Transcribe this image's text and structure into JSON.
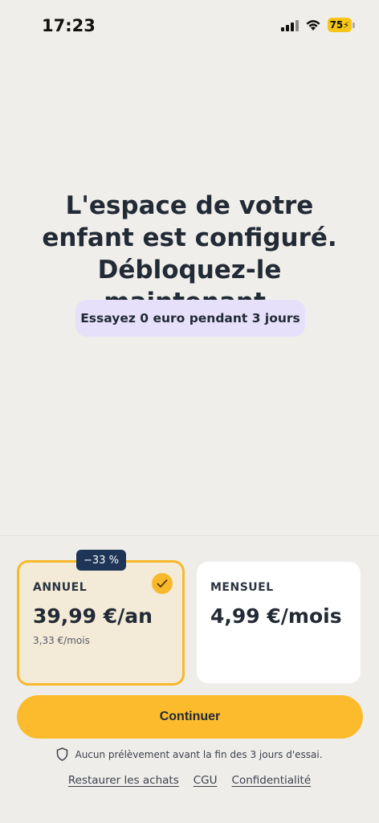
{
  "status_bar": {
    "time": "17:23",
    "battery": "75"
  },
  "main": {
    "headline": "L'espace de votre enfant est configuré. Débloquez-le maintenant.",
    "trial_pill": "Essayez 0 euro pendant 3 jours"
  },
  "plans": {
    "annual": {
      "badge": "−33 %",
      "label": "ANNUEL",
      "price": "39,99 €/an",
      "per_month": "3,33 €/mois",
      "selected": true
    },
    "monthly": {
      "label": "MENSUEL",
      "price": "4,99 €/mois"
    }
  },
  "cta": {
    "continue_label": "Continuer"
  },
  "footer": {
    "note": "Aucun prélèvement avant la fin des 3 jours d'essai.",
    "links": {
      "restore": "Restaurer les achats",
      "terms": "CGU",
      "privacy": "Confidentialité"
    }
  },
  "colors": {
    "background": "#f0eeea",
    "accent": "#fbbb2c",
    "badge": "#1e3557",
    "pill": "#e6e0fa"
  }
}
